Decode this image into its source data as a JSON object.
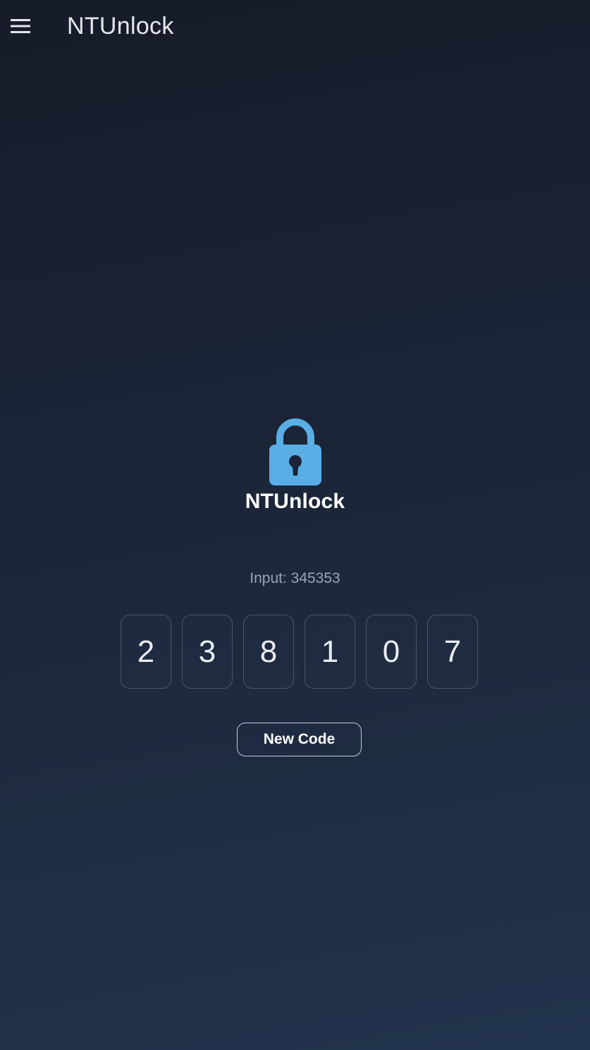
{
  "app_bar": {
    "menu_icon": "hamburger-menu-icon",
    "title": "NTUnlock"
  },
  "logo": {
    "icon": "padlock-icon",
    "icon_color": "#5aaee6",
    "text": "NTUnlock"
  },
  "input_line": {
    "label": "Input:",
    "value": "345353",
    "text": "Input: 345353"
  },
  "code": {
    "digits": [
      "2",
      "3",
      "8",
      "1",
      "0",
      "7"
    ]
  },
  "new_code_button": {
    "label": "New Code"
  }
}
